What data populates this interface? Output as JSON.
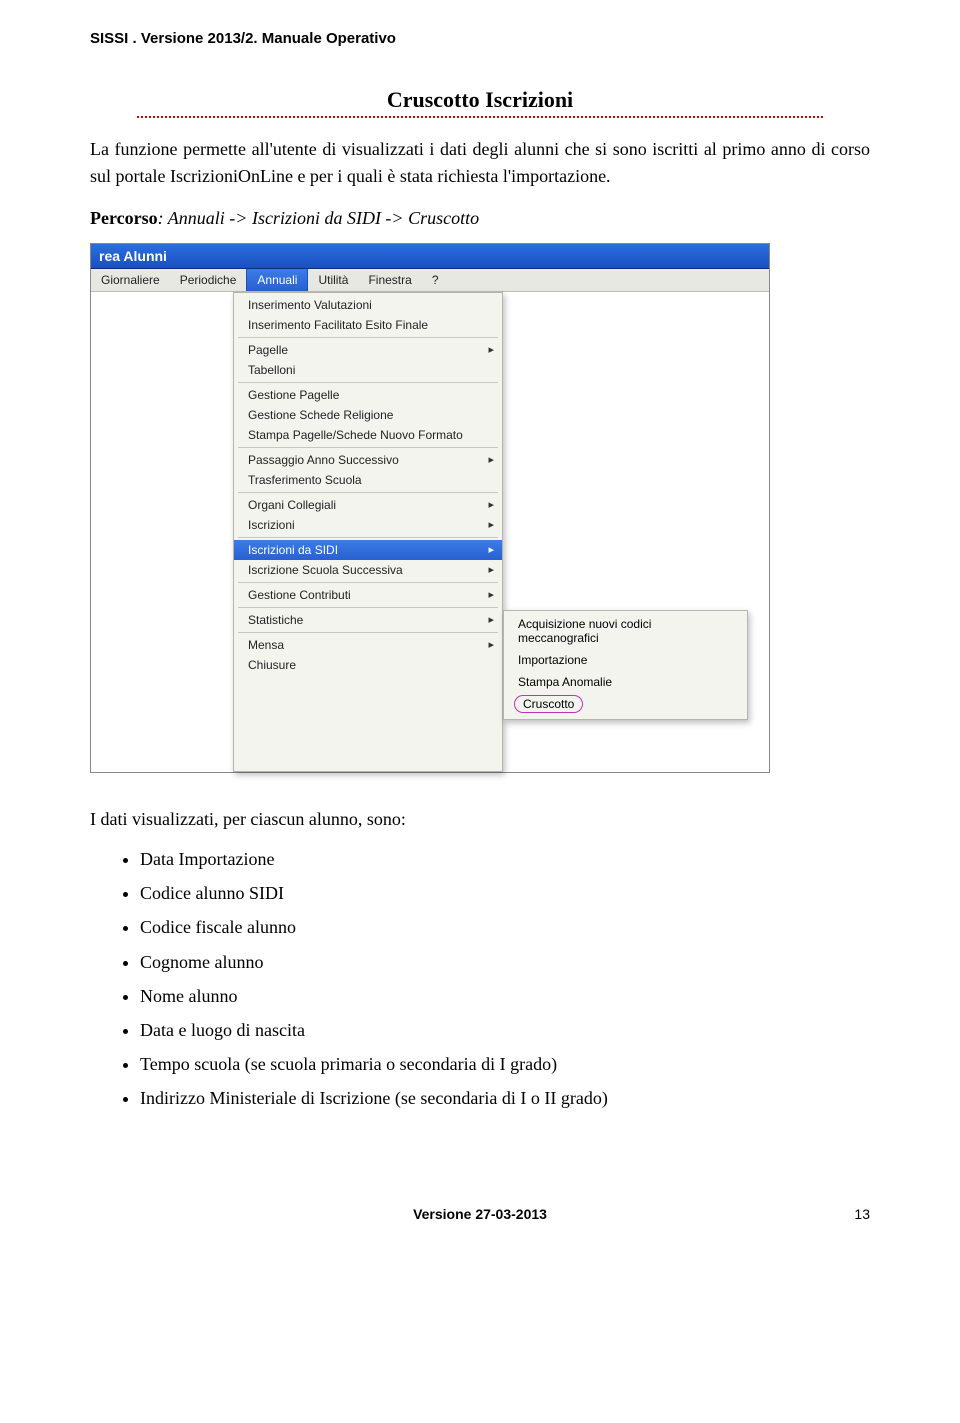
{
  "header": "SISSI . Versione 2013/2. Manuale Operativo",
  "section_title": "Cruscotto Iscrizioni",
  "intro": "La funzione permette all'utente di visualizzati i dati degli alunni che si sono iscritti al primo anno di corso sul portale IscrizioniOnLine e per i quali è stata richiesta l'importazione.",
  "percorso_label": "Percorso",
  "percorso_path": ": Annuali -> Iscrizioni da SIDI -> Cruscotto",
  "app": {
    "title": "rea Alunni",
    "menu": [
      "Giornaliere",
      "Periodiche",
      "Annuali",
      "Utilità",
      "Finestra",
      "?"
    ],
    "active_menu_index": 2,
    "dropdown_groups": [
      {
        "items": [
          {
            "label": "Inserimento Valutazioni",
            "arrow": false
          },
          {
            "label": "Inserimento Facilitato Esito Finale",
            "arrow": false
          }
        ]
      },
      {
        "items": [
          {
            "label": "Pagelle",
            "arrow": true
          },
          {
            "label": "Tabelloni",
            "arrow": false
          }
        ]
      },
      {
        "items": [
          {
            "label": "Gestione Pagelle",
            "arrow": false
          },
          {
            "label": "Gestione Schede Religione",
            "arrow": false
          },
          {
            "label": "Stampa Pagelle/Schede Nuovo Formato",
            "arrow": false
          }
        ]
      },
      {
        "items": [
          {
            "label": "Passaggio Anno Successivo",
            "arrow": true
          },
          {
            "label": "Trasferimento Scuola",
            "arrow": false
          }
        ]
      },
      {
        "items": [
          {
            "label": "Organi Collegiali",
            "arrow": true
          },
          {
            "label": "Iscrizioni",
            "arrow": true
          }
        ]
      },
      {
        "items": [
          {
            "label": "Iscrizioni da SIDI",
            "arrow": true,
            "hl": true
          },
          {
            "label": "Iscrizione Scuola Successiva",
            "arrow": true
          }
        ]
      },
      {
        "items": [
          {
            "label": "Gestione Contributi",
            "arrow": true
          }
        ]
      },
      {
        "items": [
          {
            "label": "Statistiche",
            "arrow": true
          }
        ]
      },
      {
        "items": [
          {
            "label": "Mensa",
            "arrow": true
          },
          {
            "label": "Chiusure",
            "arrow": false
          }
        ]
      }
    ],
    "submenu": [
      {
        "label": "Acquisizione nuovi codici meccanografici",
        "outlined": false
      },
      {
        "label": "Importazione",
        "outlined": false
      },
      {
        "label": "Stampa Anomalie",
        "outlined": false
      },
      {
        "label": "Cruscotto",
        "outlined": true
      }
    ]
  },
  "list_intro": "I dati visualizzati, per ciascun alunno, sono:",
  "data_list": [
    "Data Importazione",
    "Codice alunno SIDI",
    "Codice fiscale alunno",
    "Cognome alunno",
    "Nome alunno",
    "Data e luogo di nascita",
    "Tempo scuola (se scuola primaria o secondaria di I grado)",
    "Indirizzo Ministeriale di Iscrizione (se secondaria di I o II grado)"
  ],
  "footer_version": "Versione 27-03-2013",
  "footer_page": "13"
}
